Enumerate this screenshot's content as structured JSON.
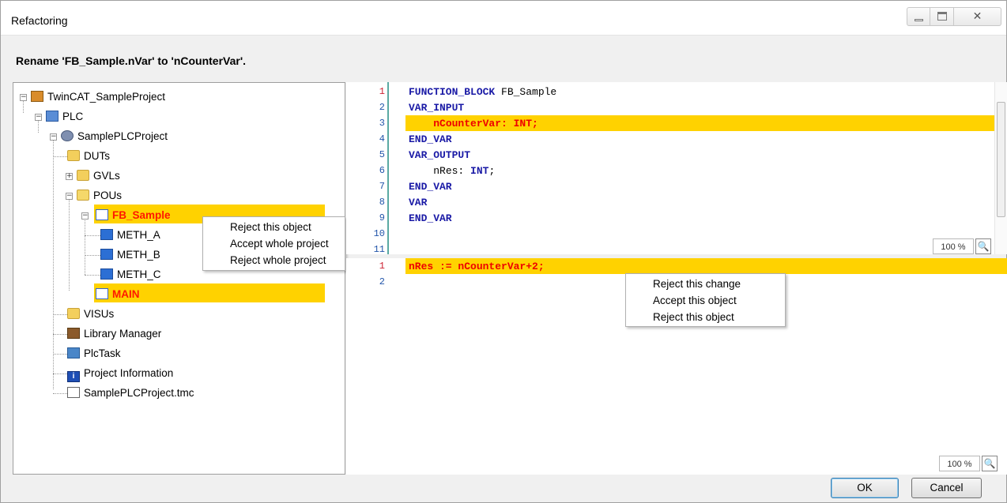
{
  "window": {
    "title": "Refactoring",
    "minimize_glyph": "—",
    "maximize_glyph": "☐",
    "close_glyph": "✕"
  },
  "heading": "Rename 'FB_Sample.nVar' to 'nCounterVar'.",
  "tree": {
    "project": "TwinCAT_SampleProject",
    "plc": "PLC",
    "plc_project": "SamplePLCProject",
    "duts": "DUTs",
    "gvls": "GVLs",
    "pous": "POUs",
    "fb_sample": "FB_Sample",
    "meth_a": "METH_A",
    "meth_b": "METH_B",
    "meth_c": "METH_C",
    "main": "MAIN",
    "visus": "VISUs",
    "library_manager": "Library Manager",
    "plctask": "PlcTask",
    "project_information": "Project Information",
    "tmc_file": "SamplePLCProject.tmc"
  },
  "tree_context_menu": {
    "items": [
      "Reject this object",
      "Accept whole project",
      "Reject whole project"
    ]
  },
  "code_top": {
    "line_numbers": [
      "1",
      "2",
      "3",
      "4",
      "5",
      "6",
      "7",
      "8",
      "9",
      "10",
      "11"
    ],
    "lines": [
      {
        "kw": "FUNCTION_BLOCK",
        "rest": " FB_Sample"
      },
      {
        "kw": "VAR_INPUT",
        "rest": ""
      },
      {
        "indent": "    ",
        "hl": "nCounterVar: INT;"
      },
      {
        "kw": "END_VAR",
        "rest": ""
      },
      {
        "kw": "VAR_OUTPUT",
        "rest": ""
      },
      {
        "indent": "    ",
        "plain": "nRes: ",
        "kw2": "INT",
        "tail": ";"
      },
      {
        "kw": "END_VAR",
        "rest": ""
      },
      {
        "kw": "VAR",
        "rest": ""
      },
      {
        "kw": "END_VAR",
        "rest": ""
      }
    ],
    "zoom": "100 %"
  },
  "code_bottom": {
    "line_numbers": [
      "1",
      "2"
    ],
    "line1": "nRes := nCounterVar+2;",
    "zoom": "100 %"
  },
  "code_context_menu": {
    "items": [
      "Reject this change",
      "Accept this object",
      "Reject this object"
    ]
  },
  "buttons": {
    "ok": "OK",
    "cancel": "Cancel"
  },
  "icons": {
    "zoom": "magnifier-icon",
    "project": "project-icon",
    "folder": "folder-icon"
  },
  "colors": {
    "highlight": "#ffd200",
    "changed_text": "#ff1800",
    "keyword": "#1a1aa6"
  }
}
